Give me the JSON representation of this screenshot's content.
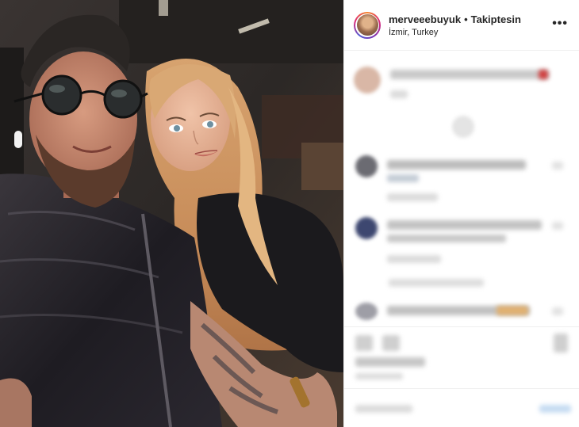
{
  "post": {
    "username": "merveeebuyuk",
    "separator": "•",
    "follow_label": "Takiptesin",
    "location": "İzmir, Turkey",
    "more_icon": "•••"
  },
  "photo": {
    "description_icon": "photo-icon"
  },
  "colors": {
    "story_ring": [
      "#f58529",
      "#dd2a7b",
      "#8134af",
      "#515bd4"
    ],
    "text": "#262626",
    "divider": "#efefef"
  }
}
